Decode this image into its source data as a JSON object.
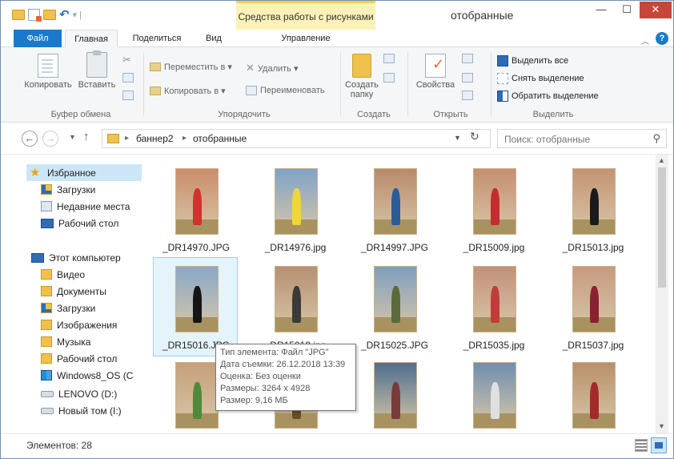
{
  "window": {
    "title": "отобранные",
    "context_tab_group": "Средства работы с рисунками",
    "minimize_glyph": "—",
    "maximize_glyph": "☐",
    "close_glyph": "✕"
  },
  "ribbon_tabs": [
    {
      "label": "Файл"
    },
    {
      "label": "Главная"
    },
    {
      "label": "Поделиться"
    },
    {
      "label": "Вид"
    },
    {
      "label": "Управление"
    }
  ],
  "ribbon": {
    "clipboard": {
      "copy": "Копировать",
      "paste": "Вставить",
      "group": "Буфер обмена"
    },
    "organize": {
      "move_to": "Переместить в ▾",
      "copy_to": "Копировать в ▾",
      "delete": "Удалить ▾",
      "rename": "Переименовать",
      "group": "Упорядочить"
    },
    "new": {
      "new_folder": "Создать папку",
      "group": "Создать"
    },
    "open": {
      "properties": "Свойства",
      "group": "Открыть"
    },
    "select": {
      "select_all": "Выделить все",
      "select_none": "Снять выделение",
      "invert": "Обратить выделение",
      "group": "Выделить"
    }
  },
  "address": {
    "breadcrumbs": [
      "баннер2",
      "отобранные"
    ],
    "search_placeholder": "Поиск: отобранные"
  },
  "nav_pane": {
    "items": [
      {
        "label": "Избранное",
        "icon": "star-icon"
      },
      {
        "label": "Загрузки",
        "icon": "downloads-folder-icon"
      },
      {
        "label": "Недавние места",
        "icon": "recent-places-icon"
      },
      {
        "label": "Рабочий стол",
        "icon": "desktop-icon"
      },
      {
        "label": "Этот компьютер",
        "icon": "computer-icon"
      },
      {
        "label": "Видео",
        "icon": "video-folder-icon"
      },
      {
        "label": "Документы",
        "icon": "documents-folder-icon"
      },
      {
        "label": "Загрузки",
        "icon": "downloads-folder-icon"
      },
      {
        "label": "Изображения",
        "icon": "pictures-folder-icon"
      },
      {
        "label": "Музыка",
        "icon": "music-folder-icon"
      },
      {
        "label": "Рабочий стол",
        "icon": "desktop-folder-icon"
      },
      {
        "label": "Windows8_OS (C",
        "icon": "windows-drive-icon"
      },
      {
        "label": "LENOVO (D:)",
        "icon": "drive-icon"
      },
      {
        "label": "Новый том (I:)",
        "icon": "drive-icon"
      }
    ]
  },
  "files": [
    {
      "name": "_DR14970.JPG",
      "bg": "#c98d6a",
      "fig": "#d1322d"
    },
    {
      "name": "_DR14976.jpg",
      "bg": "#7fa3c7",
      "fig": "#f1d63a"
    },
    {
      "name": "_DR14997.JPG",
      "bg": "#b88a6a",
      "fig": "#2b5c9a"
    },
    {
      "name": "_DR15009.jpg",
      "bg": "#c58e70",
      "fig": "#c42d2d"
    },
    {
      "name": "_DR15013.jpg",
      "bg": "#c49473",
      "fig": "#1a1a1a"
    },
    {
      "name": "_DR15016.JPG",
      "bg": "#88a9c8",
      "fig": "#151515"
    },
    {
      "name": "_DR15019.jpg",
      "bg": "#b79072",
      "fig": "#3a3a3a"
    },
    {
      "name": "_DR15025.JPG",
      "bg": "#7f9fbf",
      "fig": "#5a6a3a"
    },
    {
      "name": "_DR15035.jpg",
      "bg": "#c2917a",
      "fig": "#c23b3b"
    },
    {
      "name": "_DR15037.jpg",
      "bg": "#c79a80",
      "fig": "#8a2030"
    },
    {
      "name": "",
      "bg": "#c6a07a",
      "fig": "#4f8a3a"
    },
    {
      "name": "",
      "bg": "#a9886a",
      "fig": "#6a4a2a"
    },
    {
      "name": "",
      "bg": "#4f6f8f",
      "fig": "#7a3a3a"
    },
    {
      "name": "",
      "bg": "#6e8fb0",
      "fig": "#e0e0e0"
    },
    {
      "name": "",
      "bg": "#b8906a",
      "fig": "#a32a2a"
    }
  ],
  "tooltip": {
    "lines": [
      "Тип элемента: Файл \"JPG\"",
      "Дата съемки: 26.12.2018 13:39",
      "Оценка: Без оценки",
      "Размеры: 3264 x 4928",
      "Размер: 9,16 МБ"
    ]
  },
  "status": {
    "count": "Элементов: 28"
  },
  "colors": {
    "accent": "#1979ca",
    "context_tab": "#fcf1b8",
    "close_button": "#c7463a",
    "selection": "#e5f3fb"
  }
}
